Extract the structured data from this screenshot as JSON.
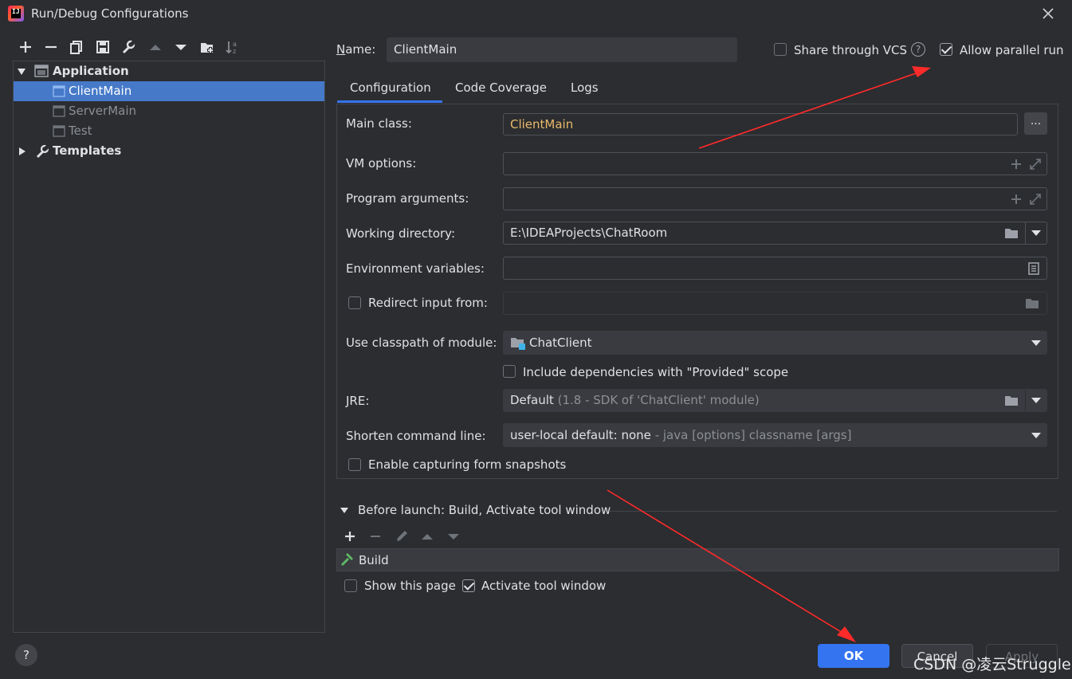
{
  "window": {
    "title": "Run/Debug Configurations"
  },
  "toolbar": {
    "icons": [
      "add-icon",
      "remove-icon",
      "copy-icon",
      "save-icon",
      "wrench-icon",
      "arrow-up-icon",
      "arrow-down-icon",
      "new-folder-icon",
      "sort-icon"
    ]
  },
  "tree": {
    "application": "Application",
    "items": [
      "ClientMain",
      "ServerMain",
      "Test"
    ],
    "templates": "Templates"
  },
  "header": {
    "name_label": "Name:",
    "name_value": "ClientMain",
    "share_vcs": "Share through VCS",
    "allow_parallel": "Allow parallel run"
  },
  "tabs": [
    "Configuration",
    "Code Coverage",
    "Logs"
  ],
  "form": {
    "main_class_label": "Main class:",
    "main_class_value": "ClientMain",
    "vm_options_label": "VM options:",
    "program_args_label": "Program arguments:",
    "working_dir_label": "Working directory:",
    "working_dir_value": "E:\\IDEAProjects\\ChatRoom",
    "env_vars_label": "Environment variables:",
    "redirect_label": "Redirect input from:",
    "classpath_label": "Use classpath of module:",
    "classpath_value": "ChatClient",
    "include_deps": "Include dependencies with \"Provided\" scope",
    "jre_label": "JRE:",
    "jre_value": "Default",
    "jre_hint": "(1.8 - SDK of 'ChatClient' module)",
    "shorten_label": "Shorten command line:",
    "shorten_value": "user-local default: none",
    "shorten_hint": "- java [options] classname [args]",
    "capture_snapshots": "Enable capturing form snapshots"
  },
  "before_launch": {
    "title": "Before launch: Build, Activate tool window",
    "item": "Build",
    "show_page": "Show this page",
    "activate_window": "Activate tool window"
  },
  "buttons": {
    "ok": "OK",
    "cancel": "Cancel",
    "apply": "Apply",
    "help": "?"
  },
  "watermark": "CSDN @凌云Struggle",
  "colors": {
    "accent": "#3574f0",
    "selection": "#4679c8",
    "annotation_arrow": "#ff2a2a",
    "main_class": "#e8b96a"
  }
}
